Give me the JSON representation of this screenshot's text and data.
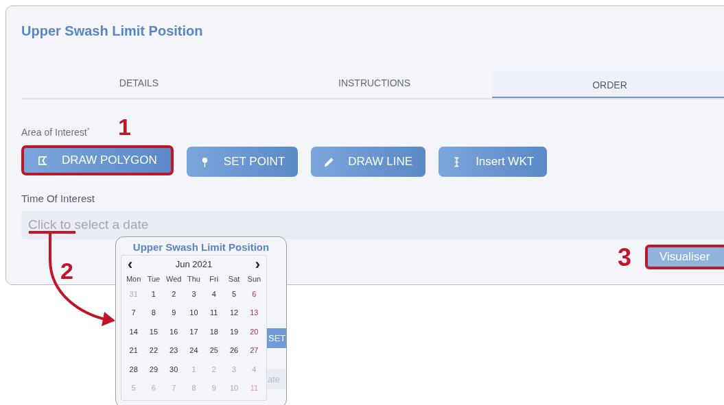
{
  "title": "Upper Swash Limit Position",
  "tabs": [
    {
      "label": "DETAILS",
      "selected": false
    },
    {
      "label": "INSTRUCTIONS",
      "selected": false
    },
    {
      "label": "ORDER",
      "selected": true
    }
  ],
  "area_of_interest": {
    "label": "Area of Interest",
    "required_mark": "*",
    "buttons": [
      {
        "label": "DRAW POLYGON",
        "kind": "polygon",
        "highlighted": true
      },
      {
        "label": "SET POINT",
        "kind": "point",
        "highlighted": false
      },
      {
        "label": "DRAW LINE",
        "kind": "line",
        "highlighted": false
      },
      {
        "label": "Insert WKT",
        "kind": "wkt",
        "highlighted": false
      }
    ]
  },
  "time_of_interest": {
    "label": "Time Of Interest",
    "placeholder": "Click to select a date"
  },
  "visualise_button": {
    "label": "Visualiser",
    "disabled": true,
    "highlighted": true
  },
  "inset": {
    "title": "Upper Swash Limit Position",
    "month": "Jun 2021",
    "prev": "‹",
    "next": "›",
    "weekdays": [
      "Mon",
      "Tue",
      "Wed",
      "Thu",
      "Fri",
      "Sat",
      "Sun"
    ],
    "days": [
      {
        "day": "31",
        "other_month": true
      },
      {
        "day": "1",
        "other_month": false
      },
      {
        "day": "2",
        "other_month": false
      },
      {
        "day": "3",
        "other_month": false
      },
      {
        "day": "4",
        "other_month": false
      },
      {
        "day": "5",
        "other_month": false
      },
      {
        "day": "6",
        "other_month": false
      },
      {
        "day": "7",
        "other_month": false
      },
      {
        "day": "8",
        "other_month": false
      },
      {
        "day": "9",
        "other_month": false
      },
      {
        "day": "10",
        "other_month": false
      },
      {
        "day": "11",
        "other_month": false
      },
      {
        "day": "12",
        "other_month": false
      },
      {
        "day": "13",
        "other_month": false
      },
      {
        "day": "14",
        "other_month": false
      },
      {
        "day": "15",
        "other_month": false
      },
      {
        "day": "16",
        "other_month": false
      },
      {
        "day": "17",
        "other_month": false
      },
      {
        "day": "18",
        "other_month": false
      },
      {
        "day": "19",
        "other_month": false
      },
      {
        "day": "20",
        "other_month": false
      },
      {
        "day": "21",
        "other_month": false
      },
      {
        "day": "22",
        "other_month": false
      },
      {
        "day": "23",
        "other_month": false
      },
      {
        "day": "24",
        "other_month": false
      },
      {
        "day": "25",
        "other_month": false
      },
      {
        "day": "26",
        "other_month": false
      },
      {
        "day": "27",
        "other_month": false
      },
      {
        "day": "28",
        "other_month": false
      },
      {
        "day": "29",
        "other_month": false
      },
      {
        "day": "30",
        "other_month": false
      },
      {
        "day": "1",
        "other_month": true
      },
      {
        "day": "2",
        "other_month": true
      },
      {
        "day": "3",
        "other_month": true
      },
      {
        "day": "4",
        "other_month": true
      },
      {
        "day": "5",
        "other_month": true
      },
      {
        "day": "6",
        "other_month": true
      },
      {
        "day": "7",
        "other_month": true
      },
      {
        "day": "8",
        "other_month": true
      },
      {
        "day": "9",
        "other_month": true
      },
      {
        "day": "10",
        "other_month": true
      },
      {
        "day": "11",
        "other_month": true
      }
    ],
    "behind_texts": [
      "SET",
      "ate"
    ]
  },
  "annotations": [
    "1",
    "2",
    "3"
  ]
}
